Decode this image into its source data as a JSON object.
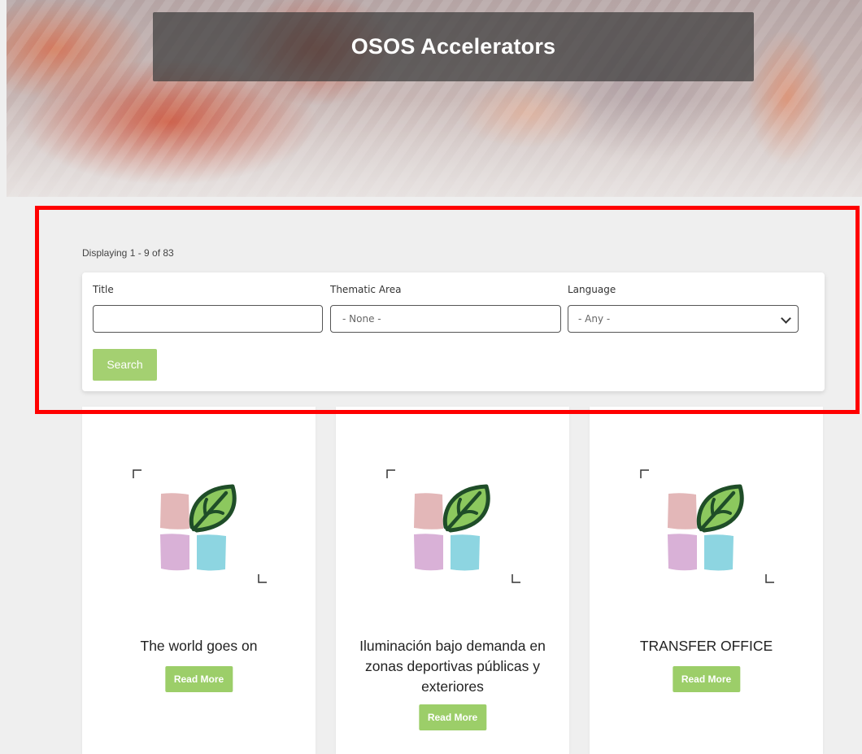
{
  "hero": {
    "title": "OSOS Accelerators"
  },
  "results": {
    "display_text": "Displaying 1 - 9 of 83"
  },
  "filters": {
    "title": {
      "label": "Title",
      "value": ""
    },
    "thematic_area": {
      "label": "Thematic Area",
      "value": "- None -"
    },
    "language": {
      "label": "Language",
      "selected": "- Any -"
    },
    "search_label": "Search"
  },
  "colors": {
    "accent": "#a4d071",
    "highlight": "#ff0000"
  },
  "cards": [
    {
      "title": "The world goes on",
      "button": "Read More"
    },
    {
      "title": "Iluminación bajo demanda en zonas deportivas públicas y exteriores",
      "button": "Read More"
    },
    {
      "title": "TRANSFER OFFICE",
      "button": "Read More"
    }
  ]
}
